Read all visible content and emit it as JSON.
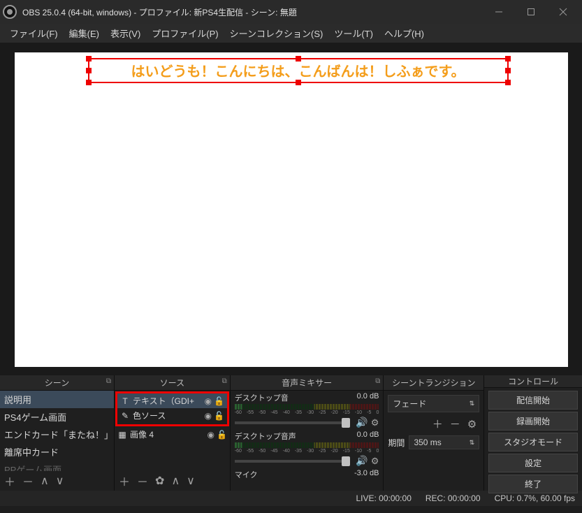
{
  "window": {
    "title": "OBS 25.0.4 (64-bit, windows) - プロファイル: 新PS4生配信 - シーン: 無題"
  },
  "menu": {
    "file": "ファイル(F)",
    "edit": "編集(E)",
    "view": "表示(V)",
    "profile": "プロファイル(P)",
    "scene_collection": "シーンコレクション(S)",
    "tools": "ツール(T)",
    "help": "ヘルプ(H)"
  },
  "preview": {
    "overlay_text": "はいどうも！こんにちは、こんばんは！しふぁです。"
  },
  "panels": {
    "scenes": {
      "title": "シーン",
      "items": [
        "説明用",
        "PS4ゲーム画面",
        "エンドカード「またね！」PS",
        "離席中カード",
        "PPゲーム画面"
      ]
    },
    "sources": {
      "title": "ソース",
      "items": [
        {
          "icon": "T",
          "label": "テキスト（GDI+",
          "hl": true
        },
        {
          "icon": "brush",
          "label": "色ソース",
          "hl": true
        },
        {
          "icon": "image",
          "label": "画像 4",
          "hl": false
        }
      ]
    },
    "mixer": {
      "title": "音声ミキサー",
      "scale": [
        "-60",
        "-55",
        "-50",
        "-45",
        "-40",
        "-35",
        "-30",
        "-25",
        "-20",
        "-15",
        "-10",
        "-5",
        "0"
      ],
      "channels": [
        {
          "name": "デスクトップ音",
          "db": "0.0 dB"
        },
        {
          "name": "デスクトップ音声",
          "db": "0.0 dB"
        },
        {
          "name": "マイク",
          "db": "-3.0 dB"
        }
      ]
    },
    "transitions": {
      "title": "シーントランジション",
      "current": "フェード",
      "duration_label": "期間",
      "duration_value": "350 ms"
    },
    "controls": {
      "title": "コントロール",
      "buttons": [
        "配信開始",
        "録画開始",
        "スタジオモード",
        "設定",
        "終了"
      ]
    }
  },
  "status": {
    "live": "LIVE: 00:00:00",
    "rec": "REC: 00:00:00",
    "cpu": "CPU: 0.7%, 60.00 fps"
  }
}
